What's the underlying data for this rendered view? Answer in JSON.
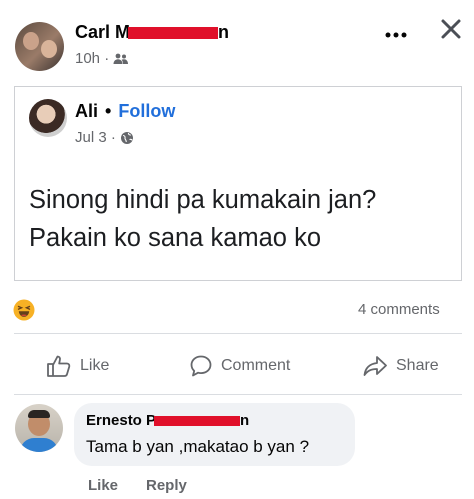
{
  "post": {
    "author_visible": "Carl M",
    "author_tail": "n",
    "time": "10h ·",
    "audience_icon": "friends-icon",
    "more_icon": "more-dots-icon",
    "close_icon": "close-icon"
  },
  "shared_post": {
    "author": "Ali",
    "separator": "•",
    "follow_label": "Follow",
    "date": "Jul 3 ·",
    "privacy_icon": "globe-icon",
    "text_line1": "Sinong hindi pa kumakain jan?",
    "text_line2": "Pakain ko sana kamao ko"
  },
  "reactions": {
    "icon": "haha-reaction-icon",
    "comments_count": "4 comments"
  },
  "actions": {
    "like_label": "Like",
    "comment_label": "Comment",
    "share_label": "Share"
  },
  "comment": {
    "author_visible": "Ernesto P",
    "author_tail": "n",
    "text": "Tama b yan ,makatao b yan ?",
    "like_label": "Like",
    "reply_label": "Reply"
  },
  "colors": {
    "follow_blue": "#216fdb",
    "redaction_red": "#e0102a",
    "muted_gray": "#65676b",
    "comment_bubble": "#f0f2f5"
  }
}
